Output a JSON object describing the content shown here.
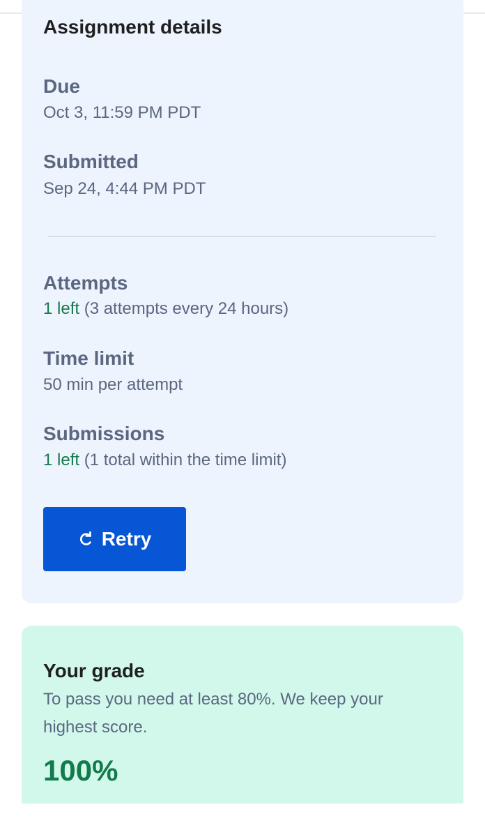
{
  "assignment_details": {
    "title": "Assignment details",
    "due": {
      "label": "Due",
      "value": "Oct 3, 11:59 PM PDT"
    },
    "submitted": {
      "label": "Submitted",
      "value": "Sep 24, 4:44 PM PDT"
    },
    "attempts": {
      "label": "Attempts",
      "highlight": "1 left",
      "detail": "(3 attempts every 24 hours)"
    },
    "time_limit": {
      "label": "Time limit",
      "value": "50 min per attempt"
    },
    "submissions": {
      "label": "Submissions",
      "highlight": "1 left",
      "detail": "(1 total within the time limit)"
    },
    "retry_button": {
      "label": "Retry",
      "icon": "refresh-icon"
    }
  },
  "grade": {
    "title": "Your grade",
    "description": "To pass you need at least 80%. We keep your highest score.",
    "score": "100%"
  },
  "colors": {
    "details_card_bg": "#eef4fd",
    "grade_card_bg": "#d2f8ec",
    "primary_button": "#0656d5",
    "success_text": "#157a4b",
    "muted_text": "#5b6780",
    "heading_text": "#1f1f1f"
  }
}
